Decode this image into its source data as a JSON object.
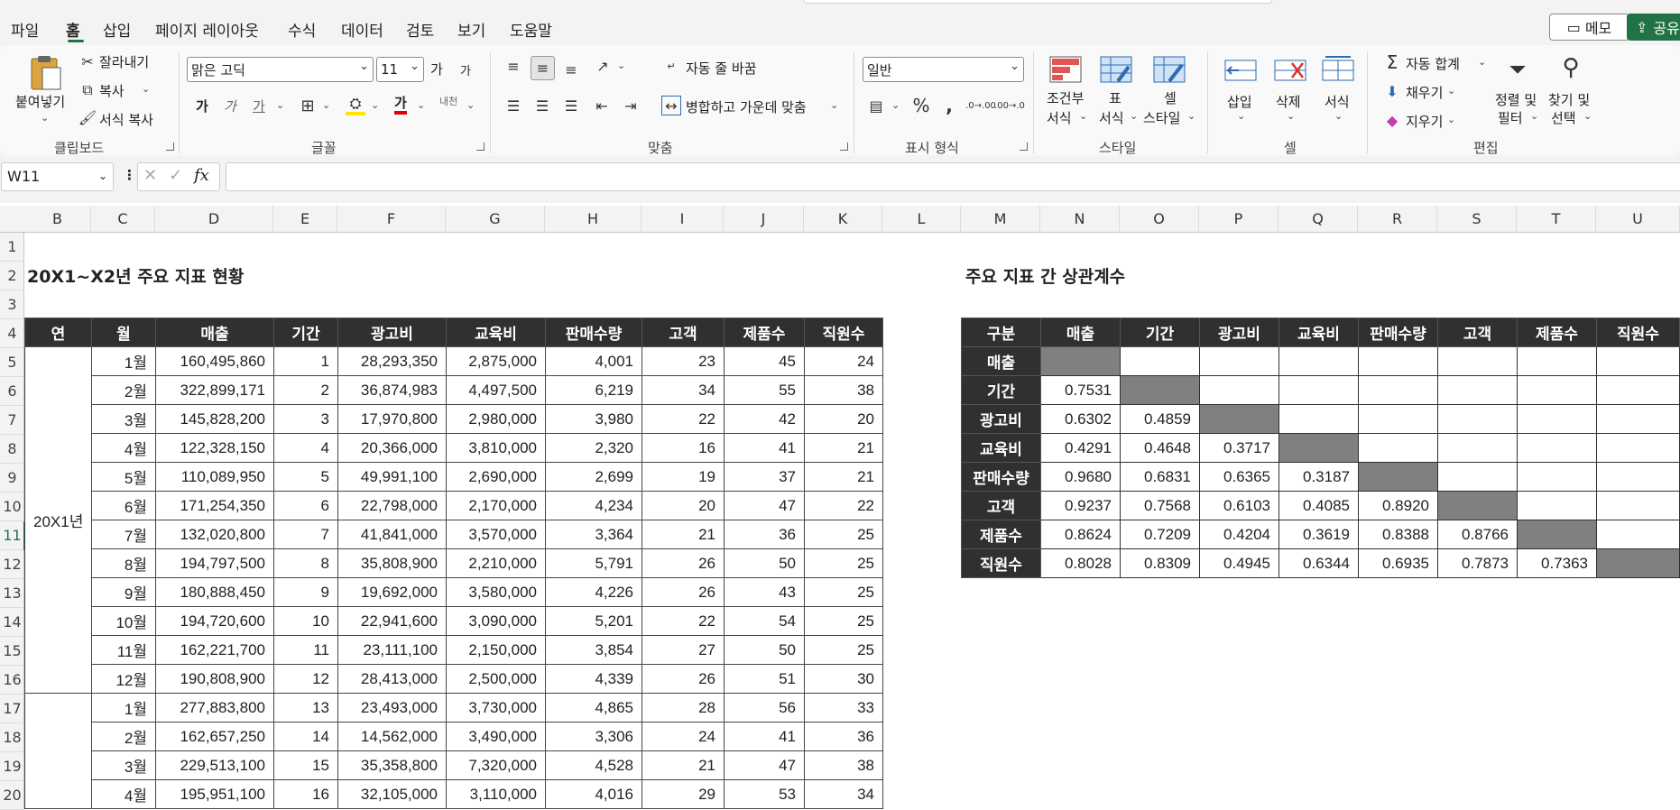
{
  "menu": {
    "tabs": [
      "파일",
      "홈",
      "삽입",
      "페이지 레이아웃",
      "수식",
      "데이터",
      "검토",
      "보기",
      "도움말"
    ],
    "active_tab": "홈",
    "memo_label": "메모",
    "share_label": "공유"
  },
  "ribbon": {
    "clipboard": {
      "paste": "붙여넣기",
      "cut": "잘라내기",
      "copy": "복사",
      "format_painter": "서식 복사",
      "group": "클립보드"
    },
    "font": {
      "name": "맑은 고딕",
      "size": "11",
      "bold": "가",
      "italic": "가",
      "underline": "가",
      "grow": "가",
      "shrink": "가",
      "phonetic": "내천",
      "group": "글꼴"
    },
    "alignment": {
      "wrap": "자동 줄 바꿈",
      "merge": "병합하고 가운데 맞춤",
      "group": "맞춤"
    },
    "number": {
      "format": "일반",
      "group": "표시 형식"
    },
    "styles": {
      "conditional": "조건부",
      "conditional2": "서식",
      "table": "표",
      "table2": "서식",
      "cell": "셀",
      "cell2": "스타일",
      "group": "스타일"
    },
    "cells": {
      "insert": "삽입",
      "delete": "삭제",
      "format": "서식",
      "group": "셀"
    },
    "editing": {
      "autosum": "자동 합계",
      "fill": "채우기",
      "clear": "지우기",
      "sort": "정렬 및",
      "sort2": "필터",
      "find": "찾기 및",
      "find2": "선택",
      "group": "편집"
    }
  },
  "formula_bar": {
    "name_box": "W11",
    "formula": ""
  },
  "columns": [
    "B",
    "C",
    "D",
    "E",
    "F",
    "G",
    "H",
    "I",
    "J",
    "K",
    "L",
    "M",
    "N",
    "O",
    "P",
    "Q",
    "R",
    "S",
    "T",
    "U"
  ],
  "rows": [
    "1",
    "2",
    "3",
    "4",
    "5",
    "6",
    "7",
    "8",
    "9",
    "10",
    "11",
    "12",
    "13",
    "14",
    "15",
    "16",
    "17",
    "18",
    "19",
    "20"
  ],
  "selected_row": "11",
  "left_title": "20X1~X2년 주요 지표 현황",
  "right_title": "주요 지표 간 상관계수",
  "main_table": {
    "headers": [
      "연",
      "월",
      "매출",
      "기간",
      "광고비",
      "교육비",
      "판매수량",
      "고객",
      "제품수",
      "직원수"
    ],
    "year1": "20X1년",
    "rows": [
      [
        "1월",
        "160,495,860",
        "1",
        "28,293,350",
        "2,875,000",
        "4,001",
        "23",
        "45",
        "24"
      ],
      [
        "2월",
        "322,899,171",
        "2",
        "36,874,983",
        "4,497,500",
        "6,219",
        "34",
        "55",
        "38"
      ],
      [
        "3월",
        "145,828,200",
        "3",
        "17,970,800",
        "2,980,000",
        "3,980",
        "22",
        "42",
        "20"
      ],
      [
        "4월",
        "122,328,150",
        "4",
        "20,366,000",
        "3,810,000",
        "2,320",
        "16",
        "41",
        "21"
      ],
      [
        "5월",
        "110,089,950",
        "5",
        "49,991,100",
        "2,690,000",
        "2,699",
        "19",
        "37",
        "21"
      ],
      [
        "6월",
        "171,254,350",
        "6",
        "22,798,000",
        "2,170,000",
        "4,234",
        "20",
        "47",
        "22"
      ],
      [
        "7월",
        "132,020,800",
        "7",
        "41,841,000",
        "3,570,000",
        "3,364",
        "21",
        "36",
        "25"
      ],
      [
        "8월",
        "194,797,500",
        "8",
        "35,808,900",
        "2,210,000",
        "5,791",
        "26",
        "50",
        "25"
      ],
      [
        "9월",
        "180,888,450",
        "9",
        "19,692,000",
        "3,580,000",
        "4,226",
        "26",
        "43",
        "25"
      ],
      [
        "10월",
        "194,720,600",
        "10",
        "22,941,600",
        "3,090,000",
        "5,201",
        "22",
        "54",
        "25"
      ],
      [
        "11월",
        "162,221,700",
        "11",
        "23,111,100",
        "2,150,000",
        "3,854",
        "27",
        "50",
        "25"
      ],
      [
        "12월",
        "190,808,900",
        "12",
        "28,413,000",
        "2,500,000",
        "4,339",
        "26",
        "51",
        "30"
      ],
      [
        "1월",
        "277,883,800",
        "13",
        "23,493,000",
        "3,730,000",
        "4,865",
        "28",
        "56",
        "33"
      ],
      [
        "2월",
        "162,657,250",
        "14",
        "14,562,000",
        "3,490,000",
        "3,306",
        "24",
        "41",
        "36"
      ],
      [
        "3월",
        "229,513,100",
        "15",
        "35,358,800",
        "7,320,000",
        "4,528",
        "21",
        "47",
        "38"
      ],
      [
        "4월",
        "195,951,100",
        "16",
        "32,105,000",
        "3,110,000",
        "4,016",
        "29",
        "53",
        "34"
      ]
    ]
  },
  "corr_table": {
    "headers": [
      "구분",
      "매출",
      "기간",
      "광고비",
      "교육비",
      "판매수량",
      "고객",
      "제품수",
      "직원수"
    ],
    "rows": [
      {
        "label": "매출",
        "values": [
          "",
          "",
          "",
          "",
          "",
          "",
          "",
          ""
        ]
      },
      {
        "label": "기간",
        "values": [
          "0.7531",
          "",
          "",
          "",
          "",
          "",
          "",
          ""
        ]
      },
      {
        "label": "광고비",
        "values": [
          "0.6302",
          "0.4859",
          "",
          "",
          "",
          "",
          "",
          ""
        ]
      },
      {
        "label": "교육비",
        "values": [
          "0.4291",
          "0.4648",
          "0.3717",
          "",
          "",
          "",
          "",
          ""
        ]
      },
      {
        "label": "판매수량",
        "values": [
          "0.9680",
          "0.6831",
          "0.6365",
          "0.3187",
          "",
          "",
          "",
          ""
        ]
      },
      {
        "label": "고객",
        "values": [
          "0.9237",
          "0.7568",
          "0.6103",
          "0.4085",
          "0.8920",
          "",
          "",
          ""
        ]
      },
      {
        "label": "제품수",
        "values": [
          "0.8624",
          "0.7209",
          "0.4204",
          "0.3619",
          "0.8388",
          "0.8766",
          "",
          ""
        ]
      },
      {
        "label": "직원수",
        "values": [
          "0.8028",
          "0.8309",
          "0.4945",
          "0.6344",
          "0.6935",
          "0.7873",
          "0.7363",
          ""
        ]
      }
    ],
    "diagonal_color": "#808080"
  },
  "colors": {
    "accent": "#217346",
    "header_bg": "#303030"
  }
}
